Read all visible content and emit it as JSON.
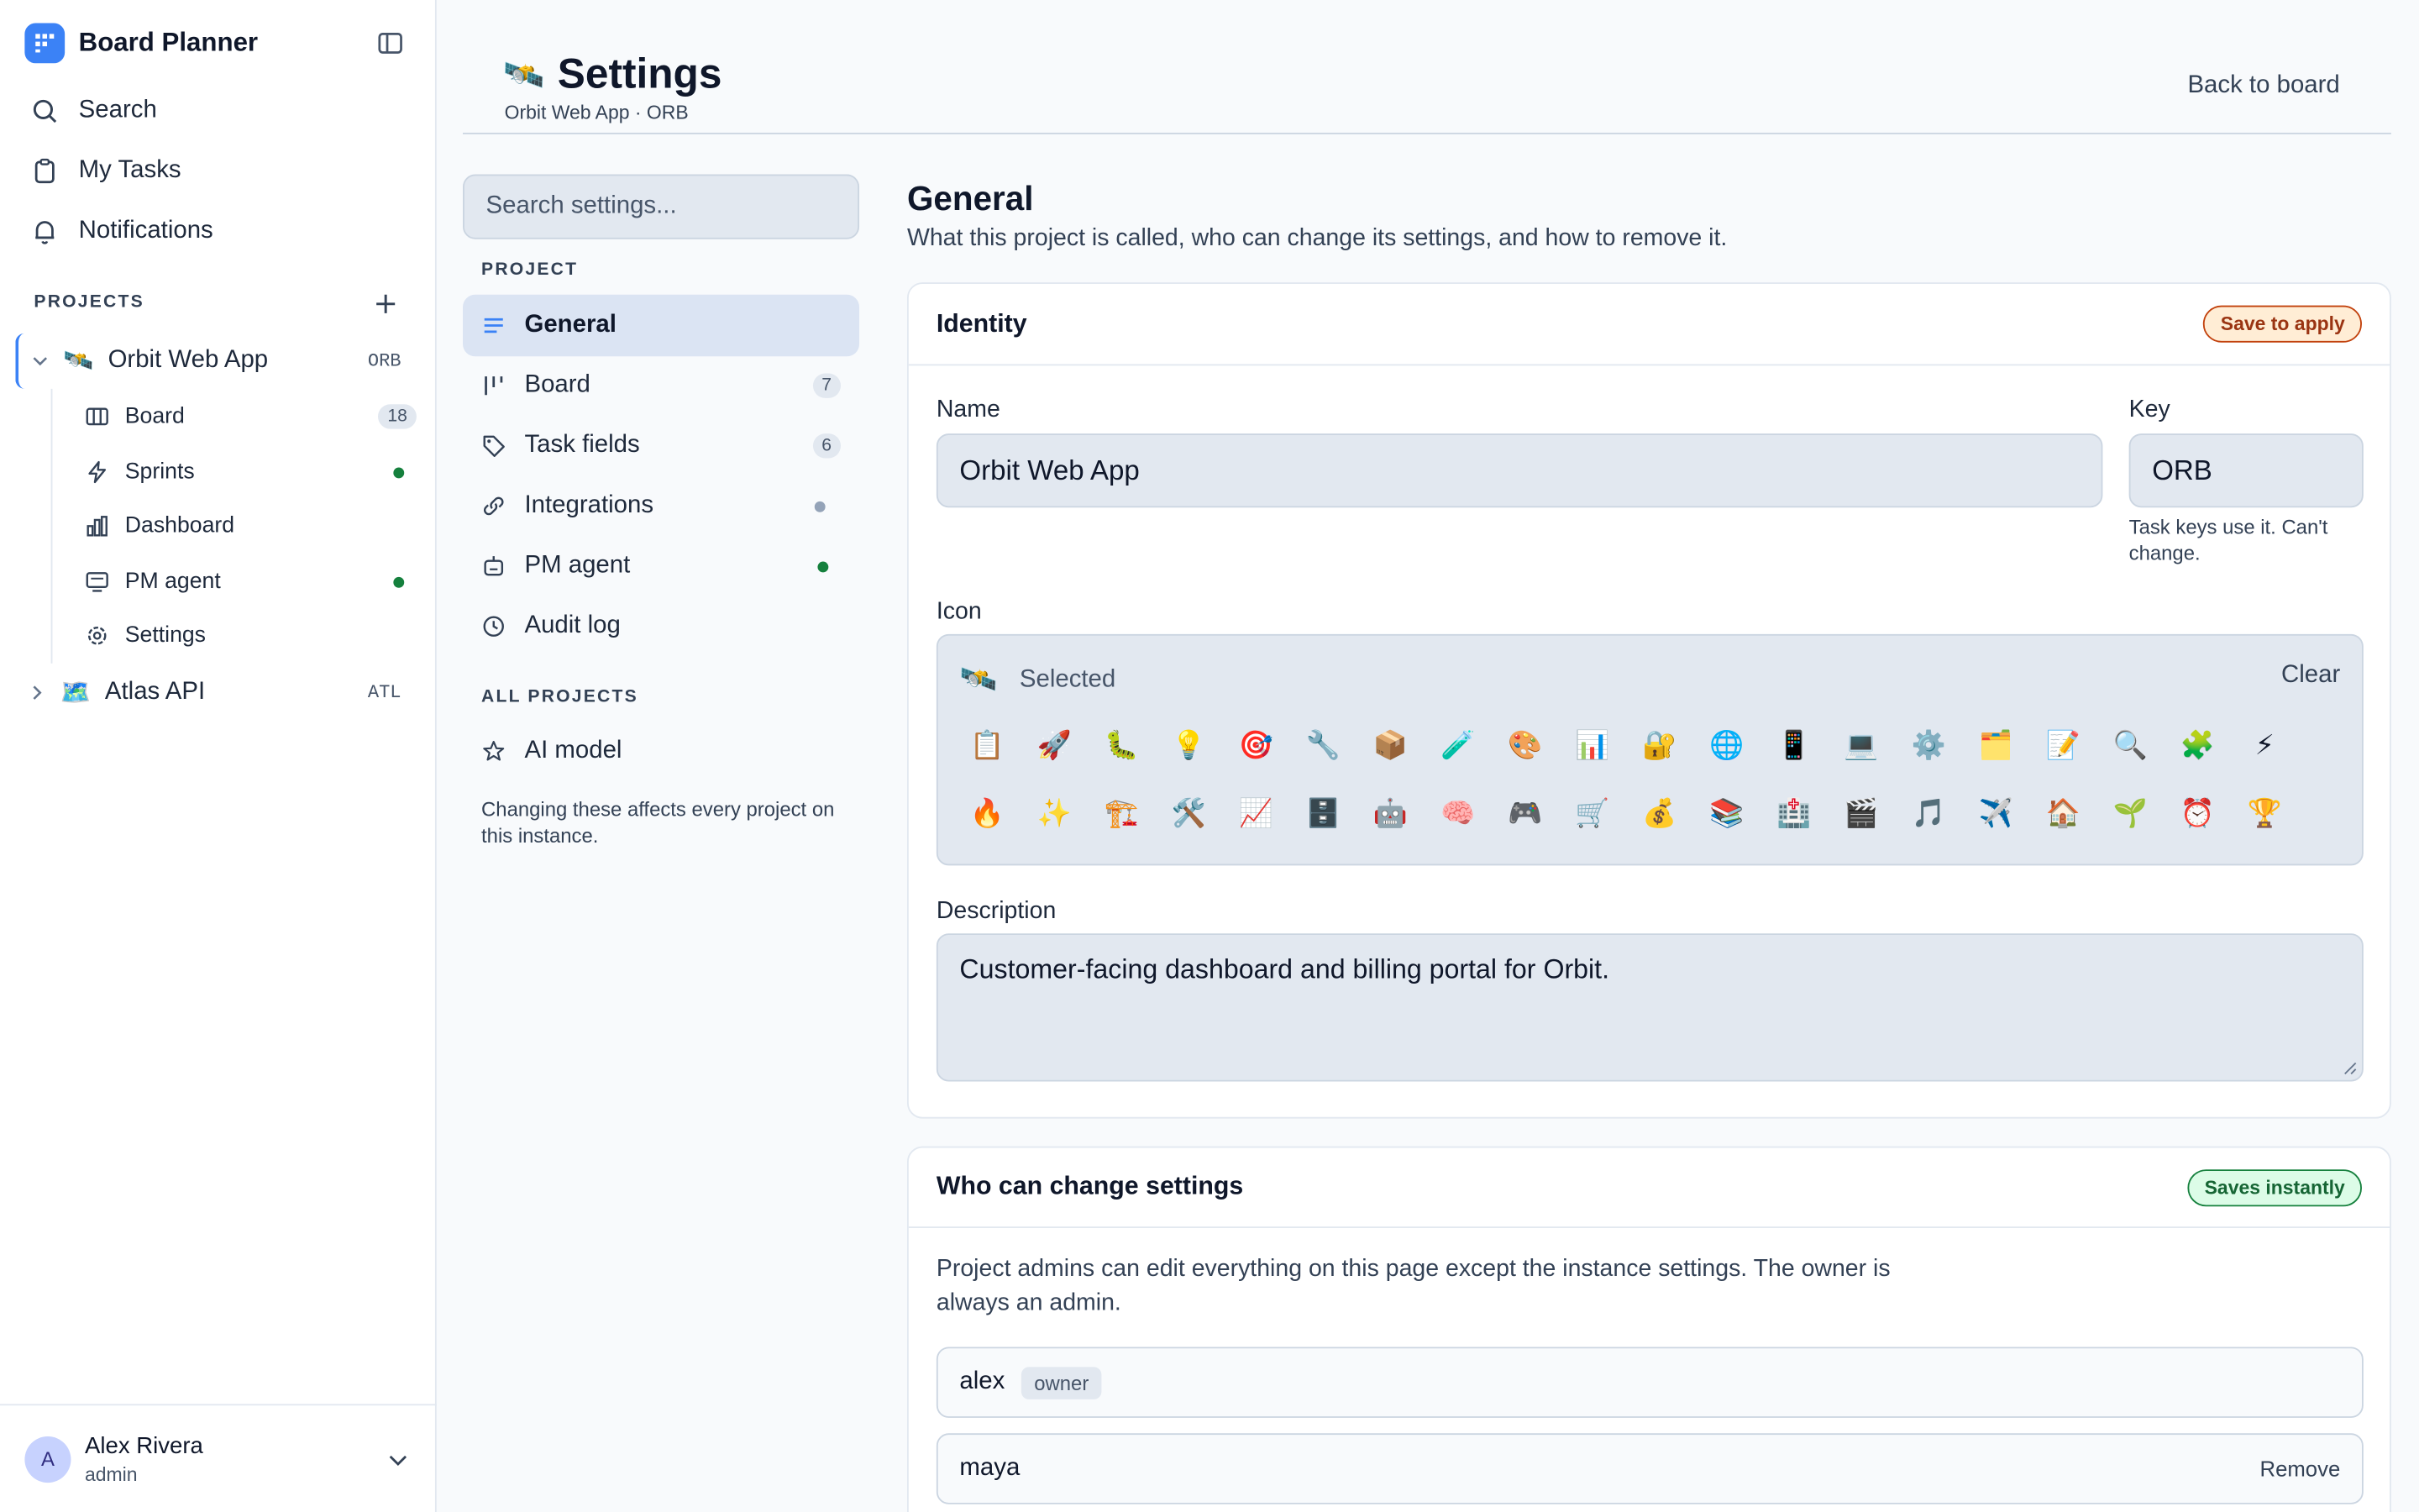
{
  "app": {
    "name": "Board Planner"
  },
  "nav": {
    "search": "Search",
    "my_tasks": "My Tasks",
    "notifications": "Notifications"
  },
  "projects": {
    "label": "PROJECTS",
    "items": [
      {
        "name": "Orbit Web App",
        "key": "ORB",
        "emoji": "🛰️"
      },
      {
        "name": "Atlas API",
        "key": "ATL",
        "emoji": "🗺️"
      }
    ],
    "sub_items": [
      {
        "label": "Board",
        "count": "18"
      },
      {
        "label": "Sprints"
      },
      {
        "label": "Dashboard"
      },
      {
        "label": "PM agent"
      },
      {
        "label": "Settings"
      }
    ]
  },
  "user": {
    "initial": "A",
    "name": "Alex Rivera",
    "role": "admin"
  },
  "header": {
    "emoji": "🛰️",
    "title": "Settings",
    "subtitle": "Orbit Web App · ORB",
    "back": "Back to board"
  },
  "settings_nav": {
    "search_placeholder": "Search settings...",
    "project_label": "PROJECT",
    "items": [
      {
        "label": "General"
      },
      {
        "label": "Board",
        "count": "7"
      },
      {
        "label": "Task fields",
        "count": "6"
      },
      {
        "label": "Integrations"
      },
      {
        "label": "PM agent"
      },
      {
        "label": "Audit log"
      }
    ],
    "all_label": "ALL PROJECTS",
    "ai_model": "AI model",
    "note": "Changing these affects every project on this instance."
  },
  "general": {
    "title": "General",
    "description": "What this project is called, who can change its settings, and how to remove it."
  },
  "identity": {
    "title": "Identity",
    "badge": "Save to apply",
    "name_label": "Name",
    "name_value": "Orbit Web App",
    "key_label": "Key",
    "key_value": "ORB",
    "key_help": "Task keys use it. Can't change.",
    "icon_label": "Icon",
    "icon_selected_emoji": "🛰️",
    "icon_selected_text": "Selected",
    "clear": "Clear",
    "emoji_row1": [
      "📋",
      "🚀",
      "🐛",
      "💡",
      "🎯",
      "🔧",
      "📦",
      "🧪",
      "🎨",
      "📊",
      "🔐",
      "🌐",
      "📱",
      "💻",
      "⚙️",
      "🗂️",
      "📝",
      "🔍",
      "🧩",
      "⚡"
    ],
    "emoji_row2": [
      "🔥",
      "✨",
      "🏗️",
      "🛠️",
      "📈",
      "🗄️",
      "🤖",
      "🧠",
      "🎮",
      "🛒",
      "💰",
      "📚",
      "🏥",
      "🎬",
      "🎵",
      "✈️",
      "🏠",
      "🌱",
      "⏰",
      "🏆"
    ],
    "desc_label": "Description",
    "desc_value": "Customer-facing dashboard and billing portal for Orbit."
  },
  "permissions": {
    "title": "Who can change settings",
    "badge": "Saves instantly",
    "text": "Project admins can edit everything on this page except the instance settings. The owner is always an admin.",
    "members": [
      {
        "name": "alex",
        "tag": "owner"
      },
      {
        "name": "maya",
        "action": "Remove"
      }
    ]
  },
  "colors": {
    "accent": "#3b82f6",
    "active_bg": "#dbe4f3",
    "green": "#15803d",
    "orange": "#c2410c"
  }
}
